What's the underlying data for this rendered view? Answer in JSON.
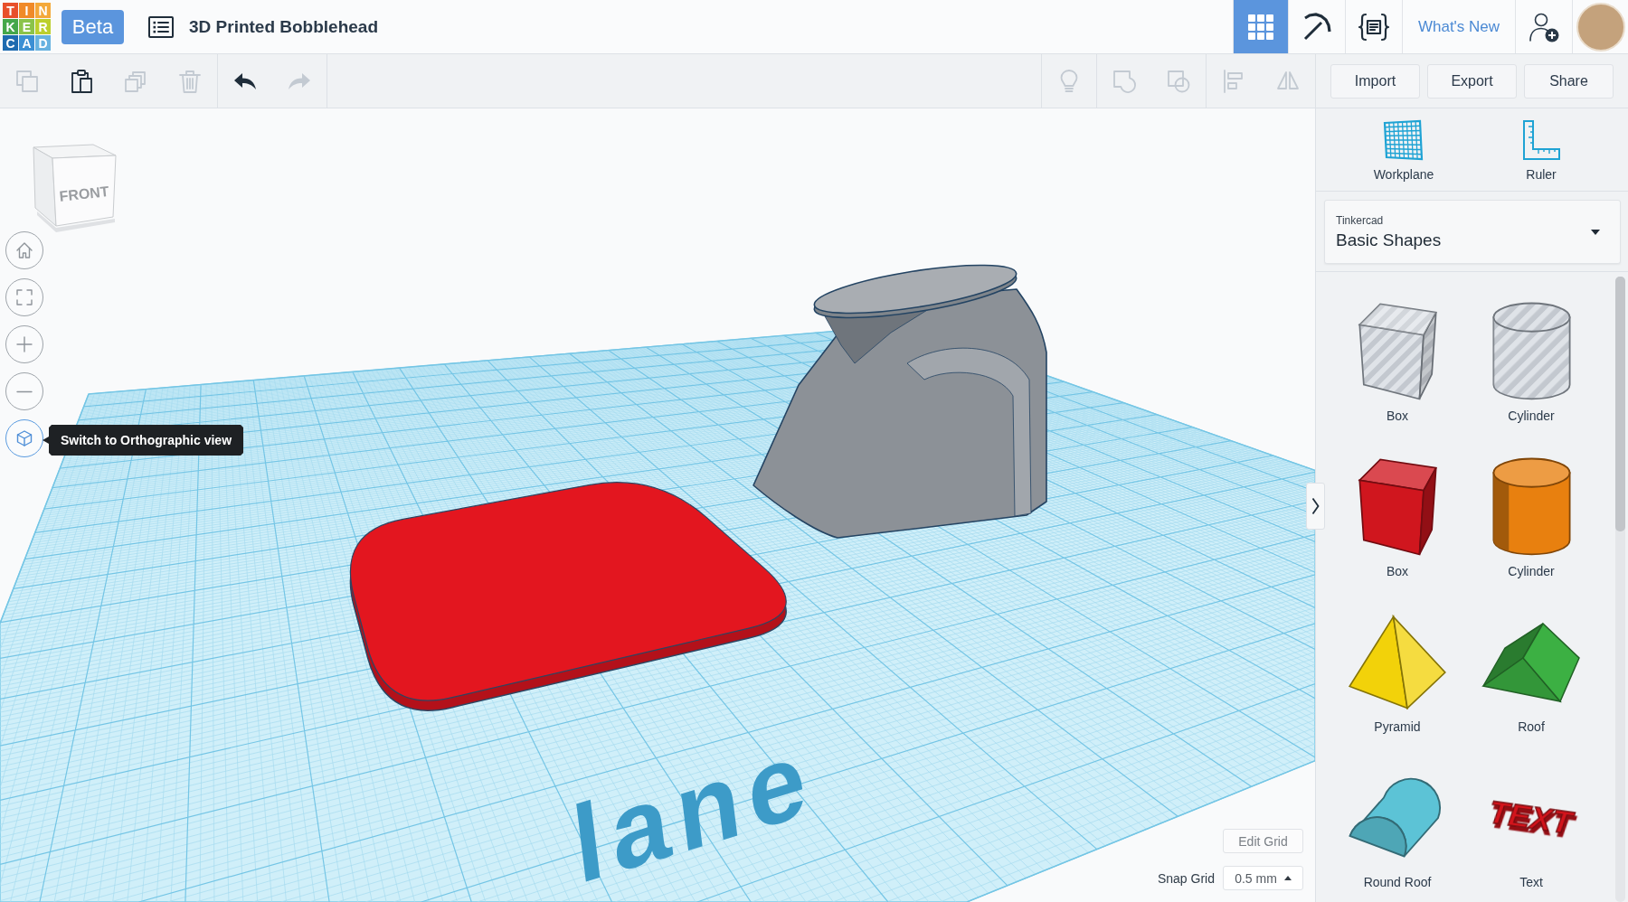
{
  "header": {
    "logo": {
      "tiles": [
        {
          "letter": "T",
          "color": "#e8502b"
        },
        {
          "letter": "I",
          "color": "#f08a28"
        },
        {
          "letter": "N",
          "color": "#f4a93a"
        },
        {
          "letter": "K",
          "color": "#45a74a"
        },
        {
          "letter": "E",
          "color": "#8bc34a"
        },
        {
          "letter": "R",
          "color": "#bccf2e"
        },
        {
          "letter": "C",
          "color": "#1e6bb0"
        },
        {
          "letter": "A",
          "color": "#3b8fd4"
        },
        {
          "letter": "D",
          "color": "#67b2e0"
        }
      ]
    },
    "badge": "Beta",
    "title": "3D Printed Bobblehead",
    "views": [
      {
        "kind": "grid",
        "selected": true
      },
      {
        "kind": "pickaxe",
        "selected": false
      },
      {
        "kind": "code-blocks",
        "selected": false
      }
    ],
    "whats_new": "What's New"
  },
  "toolbar": {
    "edit_tools": [
      {
        "kind": "copy",
        "disabled": true
      },
      {
        "kind": "paste",
        "disabled": false
      },
      {
        "kind": "duplicate",
        "disabled": true
      },
      {
        "kind": "delete",
        "disabled": true
      }
    ],
    "history_tools": [
      {
        "kind": "undo",
        "disabled": false
      },
      {
        "kind": "redo",
        "disabled": true
      }
    ],
    "object_tools": [
      {
        "kind": "notes",
        "disabled": true
      }
    ],
    "group_tools": [
      {
        "kind": "group",
        "disabled": true
      },
      {
        "kind": "ungroup",
        "disabled": true
      }
    ],
    "arrange_tools": [
      {
        "kind": "align",
        "disabled": true
      },
      {
        "kind": "mirror",
        "disabled": true
      }
    ],
    "actions": [
      "Import",
      "Export",
      "Share"
    ]
  },
  "viewport": {
    "view_cube": {
      "face": "FRONT"
    },
    "nav_buttons": [
      {
        "kind": "home",
        "highlighted": false
      },
      {
        "kind": "fit",
        "highlighted": false
      },
      {
        "kind": "zoom-in",
        "highlighted": false
      },
      {
        "kind": "zoom-out",
        "highlighted": false
      },
      {
        "kind": "orthographic",
        "highlighted": true
      }
    ],
    "tooltip": "Switch to Orthographic view",
    "workplane_label": "lane",
    "edit_grid": "Edit Grid",
    "snap_grid": {
      "label": "Snap Grid",
      "value": "0.5 mm"
    }
  },
  "panel": {
    "tools": [
      {
        "kind": "workplane",
        "label": "Workplane"
      },
      {
        "kind": "ruler",
        "label": "Ruler"
      }
    ],
    "library": {
      "source": "Tinkercad",
      "value": "Basic Shapes"
    },
    "shapes": [
      {
        "label": "Box",
        "kind": "box",
        "hole": true
      },
      {
        "label": "Cylinder",
        "kind": "cylinder",
        "hole": true
      },
      {
        "label": "Box",
        "kind": "box",
        "hole": false,
        "color": "#d0161e"
      },
      {
        "label": "Cylinder",
        "kind": "cylinder",
        "hole": false,
        "color": "#e8800f"
      },
      {
        "label": "Pyramid",
        "kind": "pyramid",
        "hole": false,
        "color": "#f2d20a"
      },
      {
        "label": "Roof",
        "kind": "roof",
        "hole": false,
        "color": "#3cb043"
      },
      {
        "label": "Round Roof",
        "kind": "round-roof",
        "hole": false,
        "color": "#5cc3d6"
      },
      {
        "label": "Text",
        "kind": "text",
        "hole": false,
        "color": "#d3141c",
        "thumbnail_text": "TEXT"
      }
    ]
  }
}
